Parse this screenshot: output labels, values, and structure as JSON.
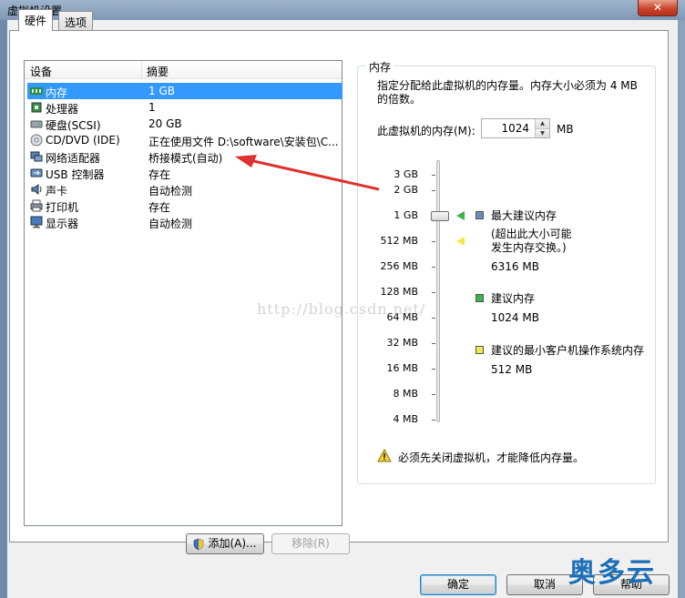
{
  "window": {
    "title": "虚拟机设置",
    "close_label": "✕"
  },
  "tabs": [
    {
      "label": "硬件"
    },
    {
      "label": "选项"
    }
  ],
  "device_list": {
    "columns": [
      "设备",
      "摘要"
    ],
    "rows": [
      {
        "name": "内存",
        "summary": "1 GB",
        "icon": "memory-icon",
        "selected": true
      },
      {
        "name": "处理器",
        "summary": "1",
        "icon": "processor-icon"
      },
      {
        "name": "硬盘(SCSI)",
        "summary": "20 GB",
        "icon": "hard-disk-icon"
      },
      {
        "name": "CD/DVD (IDE)",
        "summary": "正在使用文件 D:\\software\\安装包\\C...",
        "icon": "cd-dvd-icon"
      },
      {
        "name": "网络适配器",
        "summary": "桥接模式(自动)",
        "icon": "network-adapter-icon"
      },
      {
        "name": "USB 控制器",
        "summary": "存在",
        "icon": "usb-icon"
      },
      {
        "name": "声卡",
        "summary": "自动检测",
        "icon": "sound-card-icon"
      },
      {
        "name": "打印机",
        "summary": "存在",
        "icon": "printer-icon"
      },
      {
        "name": "显示器",
        "summary": "自动检测",
        "icon": "display-icon"
      }
    ]
  },
  "buttons": {
    "add": "添加(A)...",
    "remove": "移除(R)",
    "ok": "确定",
    "cancel": "取消",
    "help": "帮助"
  },
  "memory": {
    "group_title": "内存",
    "description": "指定分配给此虚拟机的内存量。内存大小必须为 4 MB 的倍数。",
    "field_label": "此虚拟机的内存(M):",
    "value": "1024",
    "unit": "MB",
    "scale_labels": [
      "3 GB",
      "2 GB",
      "1 GB",
      "512 MB",
      "256 MB",
      "128 MB",
      "64 MB",
      "32 MB",
      "16 MB",
      "8 MB",
      "4 MB"
    ],
    "legend": {
      "max_title": "最大建议内存",
      "max_note": "(超出此大小可能\n发生内存交换。)",
      "max_value": "6316 MB",
      "rec_title": "建议内存",
      "rec_value": "1024 MB",
      "min_title": "建议的最小客户机操作系统内存",
      "min_value": "512 MB"
    },
    "warning": "必须先关闭虚拟机，才能降低内存量。"
  },
  "overlay": {
    "watermark": "http://blog.csdn.net/",
    "brand": "奥多云"
  },
  "colors": {
    "selection": "#3399ff",
    "marker_max": "#6d8bbd",
    "marker_rec": "#3fb34f",
    "marker_min": "#f3e84a",
    "arrow": "#e03030"
  }
}
